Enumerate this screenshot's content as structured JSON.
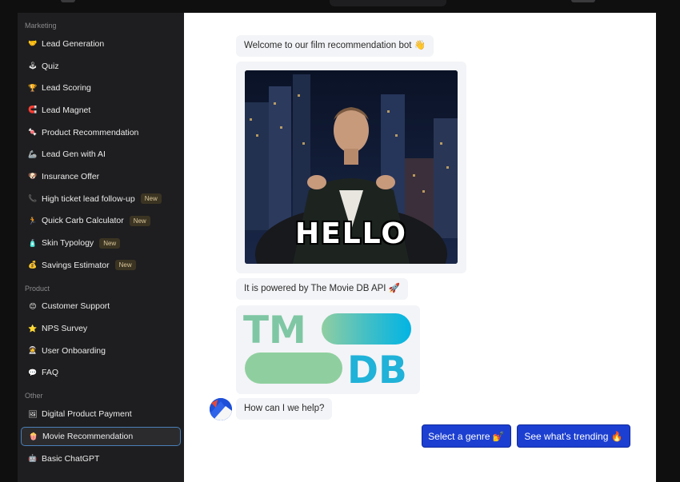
{
  "sidebar": {
    "sections": [
      {
        "label": "Marketing",
        "items": [
          {
            "icon": "handshake-icon",
            "glyph": "🤝",
            "label": "Lead Generation"
          },
          {
            "icon": "joystick-icon",
            "glyph": "🕹",
            "label": "Quiz"
          },
          {
            "icon": "trophy-icon",
            "glyph": "🏆",
            "label": "Lead Scoring"
          },
          {
            "icon": "magnet-icon",
            "glyph": "🧲",
            "label": "Lead Magnet"
          },
          {
            "icon": "candy-icon",
            "glyph": "🍬",
            "label": "Product Recommendation"
          },
          {
            "icon": "mechanical-arm-icon",
            "glyph": "🦾",
            "label": "Lead Gen with AI"
          },
          {
            "icon": "dog-icon",
            "glyph": "🐶",
            "label": "Insurance Offer"
          },
          {
            "icon": "telephone-icon",
            "glyph": "📞",
            "label": "High ticket lead follow-up",
            "badge": "New"
          },
          {
            "icon": "runner-icon",
            "glyph": "🏃",
            "label": "Quick Carb Calculator",
            "badge": "New"
          },
          {
            "icon": "lotion-icon",
            "glyph": "🧴",
            "label": "Skin Typology",
            "badge": "New"
          },
          {
            "icon": "money-bag-icon",
            "glyph": "💰",
            "label": "Savings Estimator",
            "badge": "New"
          }
        ]
      },
      {
        "label": "Product",
        "items": [
          {
            "icon": "smiling-face-icon",
            "glyph": "😊",
            "label": "Customer Support"
          },
          {
            "icon": "star-icon",
            "glyph": "⭐",
            "label": "NPS Survey"
          },
          {
            "icon": "astronaut-icon",
            "glyph": "🧑‍🚀",
            "label": "User Onboarding"
          },
          {
            "icon": "speech-bubble-icon",
            "glyph": "💬",
            "label": "FAQ"
          }
        ]
      },
      {
        "label": "Other",
        "items": [
          {
            "icon": "picture-icon",
            "glyph": "🖼",
            "label": "Digital Product Payment"
          },
          {
            "icon": "popcorn-icon",
            "glyph": "🍿",
            "label": "Movie Recommendation",
            "active": true
          },
          {
            "icon": "robot-icon",
            "glyph": "🤖",
            "label": "Basic ChatGPT"
          }
        ]
      }
    ]
  },
  "chat": {
    "welcome": "Welcome to our film recommendation bot 👋",
    "gif_caption": "HELLO",
    "powered_by": "It is powered by The Movie DB API 🚀",
    "logo_text_1": "TM",
    "logo_text_2": "DB",
    "help": "How can I we help?",
    "buttons": [
      "Select a genre 💅",
      "See what's trending 🔥"
    ]
  },
  "colors": {
    "accent": "#1c3fd1",
    "tmdb_green": "#90cea1",
    "tmdb_blue": "#01b4e4"
  }
}
